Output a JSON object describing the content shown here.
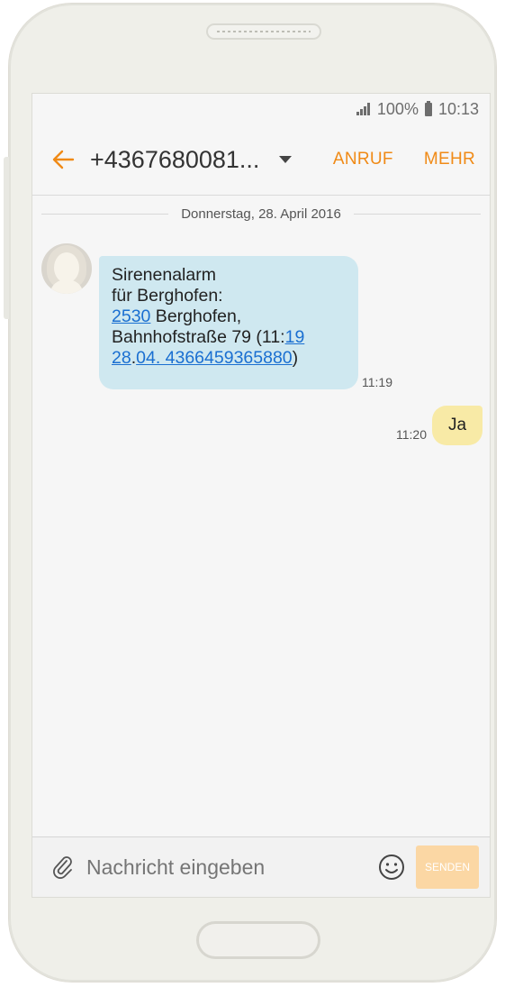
{
  "status_bar": {
    "battery": "100%",
    "time": "10:13"
  },
  "header": {
    "contact": "+4367680081...",
    "call_label": "ANRUF",
    "more_label": "MEHR"
  },
  "date_separator": "Donnerstag, 28. April 2016",
  "messages": [
    {
      "direction": "incoming",
      "lines": {
        "l1": "Sirenenalarm",
        "l2": "für Berghofen:",
        "l3_link": "2530",
        "l3_text": " Berghofen,",
        "l4_text": "Bahnhofstraße 79 (11:",
        "l4_link": "19",
        "l5_link1": "28",
        "l5_dot": ".",
        "l5_link2": "04. 4366459365880",
        "l5_end": ")"
      },
      "time": "11:19"
    },
    {
      "direction": "outgoing",
      "text": "Ja",
      "time": "11:20"
    }
  ],
  "composer": {
    "placeholder": "Nachricht eingeben",
    "send_label": "SENDEN"
  },
  "colors": {
    "accent": "#f08a16",
    "incoming_bubble": "#cfe8f0",
    "outgoing_bubble": "#f8eaa6",
    "send_button": "#fbd7a4"
  },
  "icons": [
    "back-arrow-icon",
    "dropdown-caret-icon",
    "signal-icon",
    "battery-icon",
    "paperclip-icon",
    "emoji-icon"
  ]
}
